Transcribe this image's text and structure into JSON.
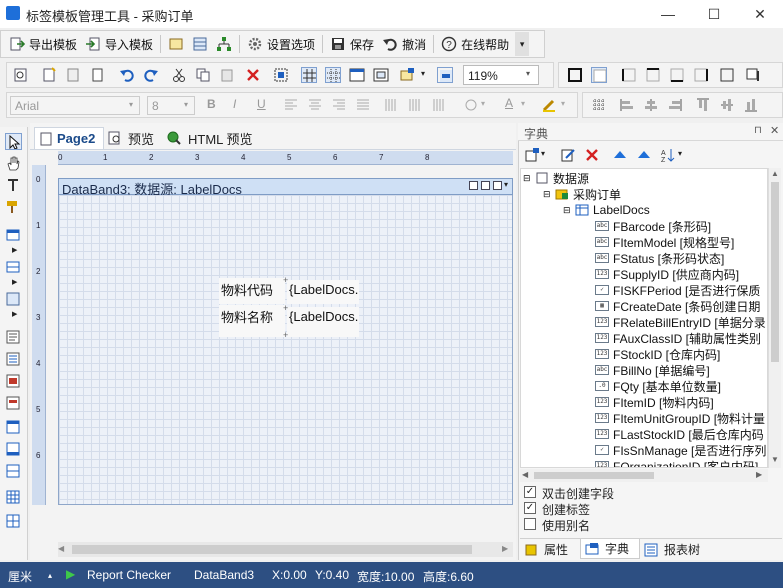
{
  "window": {
    "title": "标签模板管理工具 - 采购订单",
    "minimize": "—",
    "maximize": "☐",
    "close": "✕"
  },
  "command_bar": {
    "export_label": "导出模板",
    "import_label": "导入模板",
    "settings_label": "设置选项",
    "save_label": "保存",
    "undo_label": "撤消",
    "help_label": "在线帮助",
    "dropdown": "▾"
  },
  "format_toolbar": {
    "zoom_value": "119%",
    "font_name": "Arial",
    "font_size": "8",
    "bold": "B",
    "italic": "I",
    "underline": "U",
    "text_color_letter": "A"
  },
  "designer": {
    "tabs": [
      {
        "label": "Page2"
      },
      {
        "label": "预览"
      },
      {
        "label": "HTML 预览"
      }
    ],
    "hruler_ticks": [
      "0",
      "1",
      "2",
      "3",
      "4",
      "5",
      "6",
      "7",
      "8"
    ],
    "vruler_ticks": [
      "0",
      "1",
      "2",
      "3",
      "4",
      "5",
      "6"
    ],
    "band_title": "DataBand3; 数据源: LabelDocs",
    "cells": [
      {
        "text": "物料代码"
      },
      {
        "text": "{LabelDocs."
      },
      {
        "text": "物料名称"
      },
      {
        "text": "{LabelDocs."
      }
    ]
  },
  "right_panel": {
    "title": "字典",
    "tree": {
      "root": "数据源",
      "group": "采购订单",
      "table": "LabelDocs",
      "fields": [
        {
          "type": "abc",
          "label": "FBarcode [条形码]"
        },
        {
          "type": "abc",
          "label": "FItemModel [规格型号]"
        },
        {
          "type": "abc",
          "label": "FStatus [条形码状态]"
        },
        {
          "type": "123",
          "label": "FSupplyID [供应商内码]"
        },
        {
          "type": "chk",
          "label": "FISKFPeriod [是否进行保质"
        },
        {
          "type": "date",
          "label": "FCreateDate [条码创建日期"
        },
        {
          "type": "123",
          "label": "FRelateBillEntryID [单据分录"
        },
        {
          "type": "123",
          "label": "FAuxClassID [辅助属性类别"
        },
        {
          "type": "123",
          "label": "FStockID [仓库内码]"
        },
        {
          "type": "abc",
          "label": "FBillNo [单据编号]"
        },
        {
          "type": "dec",
          "label": "FQty [基本单位数量]"
        },
        {
          "type": "123",
          "label": "FItemID [物料内码]"
        },
        {
          "type": "123",
          "label": "FItemUnitGroupID [物料计量"
        },
        {
          "type": "123",
          "label": "FLastStockID [最后仓库内码"
        },
        {
          "type": "chk",
          "label": "FIsSnManage [是否进行序列"
        },
        {
          "type": "123",
          "label": "FOrganizationID [客户内码]"
        }
      ]
    },
    "options": [
      {
        "label": "双击创建字段",
        "checked": true
      },
      {
        "label": "创建标签",
        "checked": true
      },
      {
        "label": "使用别名",
        "checked": false
      }
    ],
    "bottom_tabs": [
      {
        "label": "属性"
      },
      {
        "label": "字典"
      },
      {
        "label": "报表树"
      }
    ]
  },
  "status_bar": {
    "unit": "厘米",
    "checker": "Report Checker",
    "component": "DataBand3",
    "x": "X:0.00",
    "y": "Y:0.40",
    "width": "宽度:10.00",
    "height": "高度:6.60"
  },
  "colors": {
    "status_bar_bg": "#2d4f82",
    "band_header_bg": "#cfe0f5",
    "ruler_bg": "#cfdcef",
    "accent_blue": "#1e6fd9"
  }
}
